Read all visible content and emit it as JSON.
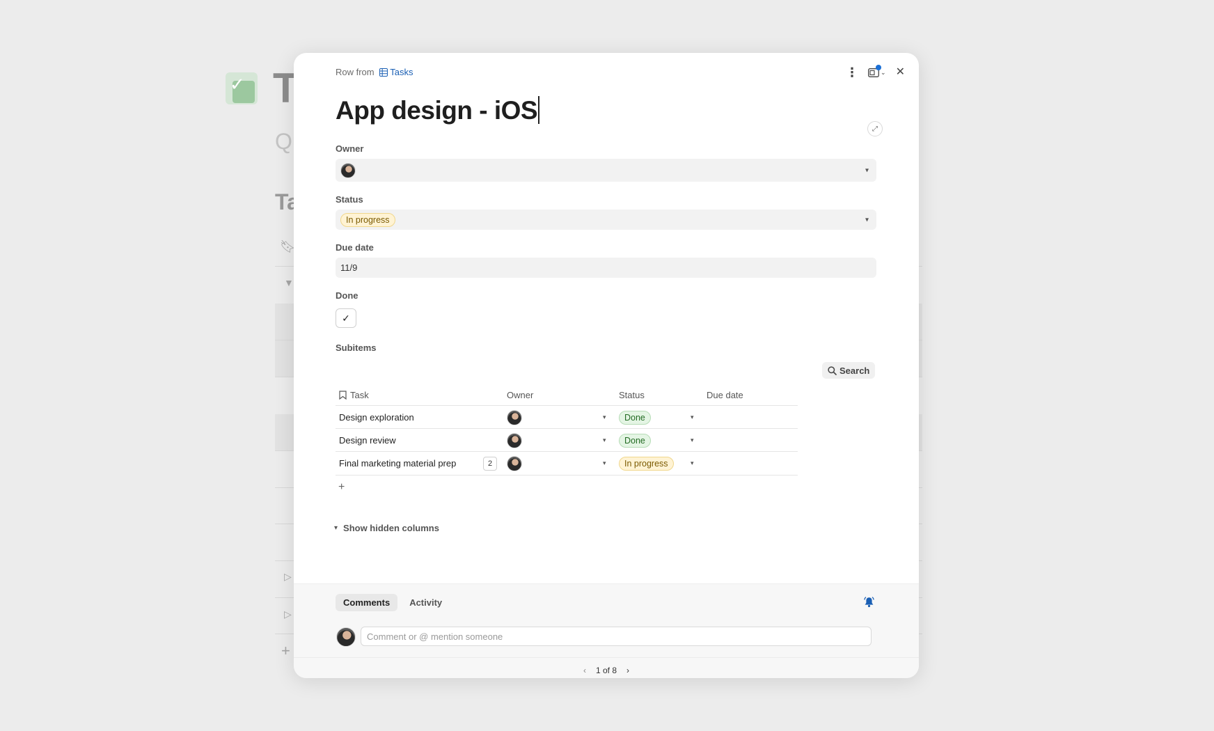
{
  "background": {
    "title_fragment": "T",
    "subtitle_fragment": "Qu",
    "heading_fragment": "Ta"
  },
  "modal": {
    "row_from_prefix": "Row from",
    "row_from_link": "Tasks",
    "title": "App design - iOS",
    "fields": {
      "owner_label": "Owner",
      "status_label": "Status",
      "status_value": "In progress",
      "due_label": "Due date",
      "due_value": "11/9",
      "done_label": "Done",
      "done_checked": true
    },
    "subitems": {
      "label": "Subitems",
      "search_label": "Search",
      "columns": [
        "Task",
        "Owner",
        "Status",
        "Due date"
      ],
      "rows": [
        {
          "task": "Design exploration",
          "status": "Done",
          "count": ""
        },
        {
          "task": "Design review",
          "status": "Done",
          "count": ""
        },
        {
          "task": "Final marketing material prep",
          "status": "In progress",
          "count": "2"
        }
      ],
      "add_label": "+",
      "hidden_columns_label": "Show hidden columns"
    },
    "footer": {
      "tabs": [
        "Comments",
        "Activity"
      ],
      "active_tab": "Comments",
      "comment_placeholder": "Comment or @ mention someone",
      "pager_text": "1 of 8"
    }
  },
  "colors": {
    "accent_blue": "#1a5fb4",
    "in_progress_bg": "#fff3d4",
    "done_bg": "#e4f5e4"
  }
}
